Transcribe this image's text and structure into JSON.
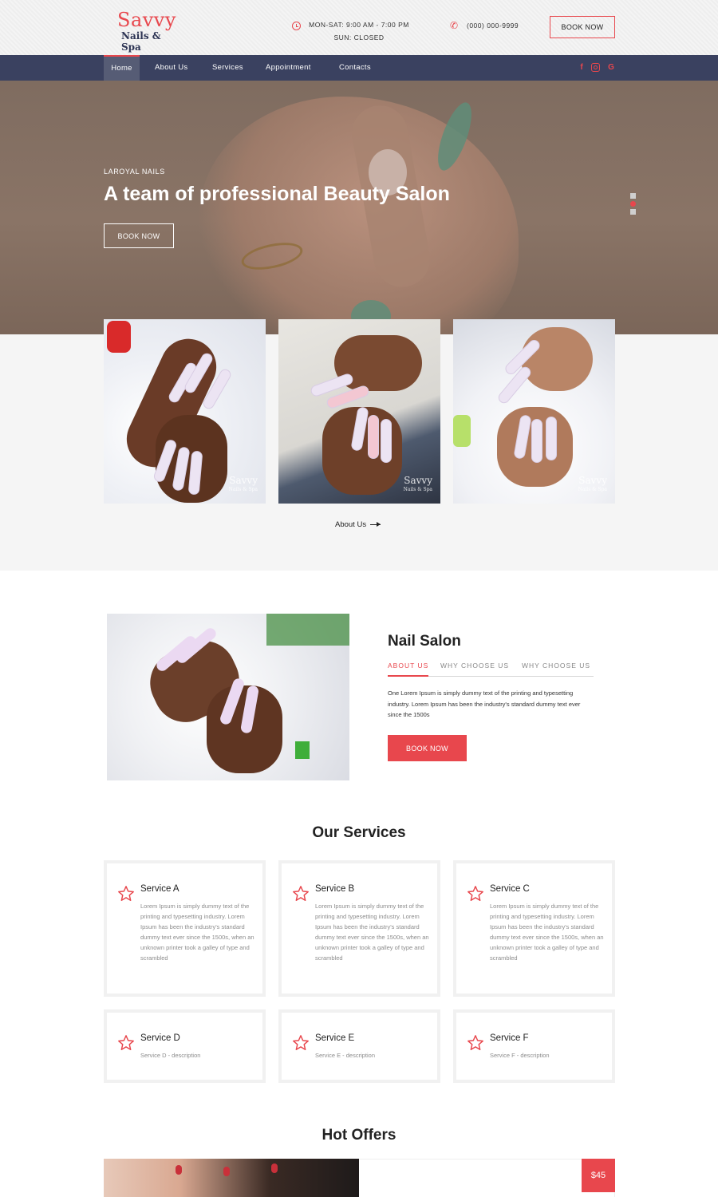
{
  "header": {
    "logo_main": "Savvy",
    "logo_sub": "Nails & Spa",
    "hours_line1": "MON-SAT:  9:00 AM - 7:00 PM",
    "hours_line2": "SUN:  CLOSED",
    "phone": "(000) 000-9999",
    "book_label": "BOOK NOW"
  },
  "nav": {
    "items": [
      "Home",
      "About Us",
      "Services",
      "Appointment",
      "Contacts"
    ],
    "active": "Home",
    "social": [
      "f",
      "o",
      "G"
    ]
  },
  "hero": {
    "eyebrow": "LAROYAL NAILS",
    "title": "A team of professional Beauty Salon",
    "button": "BOOK NOW",
    "slide_count": 3,
    "active_slide": 2
  },
  "gallery": {
    "watermark_main": "Savvy",
    "watermark_sub": "Nails & Spa",
    "link": "About Us"
  },
  "salon": {
    "title": "Nail Salon",
    "tabs": [
      "ABOUT US",
      "WHY CHOOSE US",
      "WHY CHOOSE US"
    ],
    "active_tab": "ABOUT US",
    "text": "One Lorem Ipsum is simply dummy text of the printing and typesetting industry. Lorem Ipsum has been the industry's standard dummy text ever since the 1500s",
    "button": "BOOK NOW"
  },
  "services": {
    "title": "Our Services",
    "items": [
      {
        "name": "Service A",
        "desc": "Lorem Ipsum is simply dummy text of the printing and typesetting industry. Lorem Ipsum has been the industry's standard dummy text ever since the 1500s, when an unknown printer took a galley of type and scrambled"
      },
      {
        "name": "Service B",
        "desc": "Lorem Ipsum is simply dummy text of the printing and typesetting industry. Lorem Ipsum has been the industry's standard dummy text ever since the 1500s, when an unknown printer took a galley of type and scrambled"
      },
      {
        "name": "Service C",
        "desc": "Lorem Ipsum is simply dummy text of the printing and typesetting industry. Lorem Ipsum has been the industry's standard dummy text ever since the 1500s, when an unknown printer took a galley of type and scrambled"
      },
      {
        "name": "Service D",
        "desc": "Service D - description"
      },
      {
        "name": "Service E",
        "desc": "Service E - description"
      },
      {
        "name": "Service F",
        "desc": "Service F - description"
      }
    ]
  },
  "offers": {
    "title": "Hot Offers",
    "price": "$45"
  },
  "colors": {
    "accent": "#e8474d",
    "nav_bg": "#3a4160"
  }
}
